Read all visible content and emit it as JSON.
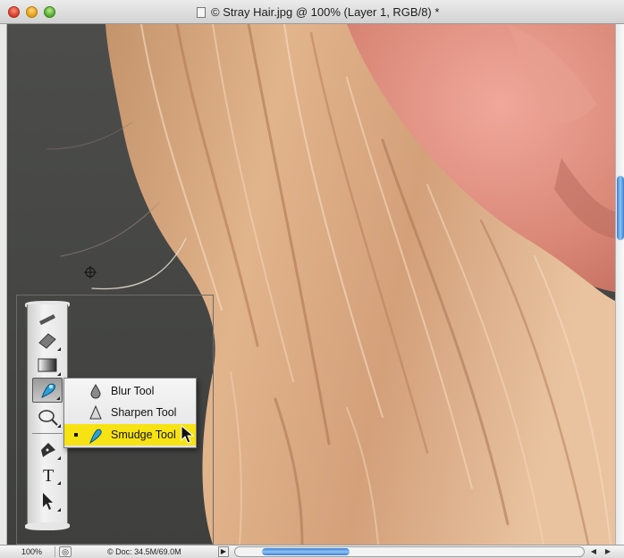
{
  "window": {
    "title": "© Stray Hair.jpg @ 100% (Layer 1, RGB/8) *"
  },
  "toolbar": {
    "tools": [
      {
        "name": "smudge-tool-group",
        "icon": "finger-smudge-icon",
        "active": true
      },
      {
        "name": "dodge-tool",
        "icon": "dodge-icon"
      },
      {
        "name": "pen-tool",
        "icon": "pen-icon"
      },
      {
        "name": "type-tool",
        "icon": "type-icon",
        "glyph": "T"
      },
      {
        "name": "path-selection-tool",
        "icon": "arrow-icon"
      }
    ]
  },
  "flyout": {
    "items": [
      {
        "label": "Blur Tool",
        "icon": "drop-icon",
        "selected": false
      },
      {
        "label": "Sharpen Tool",
        "icon": "triangle-icon",
        "selected": false
      },
      {
        "label": "Smudge Tool",
        "icon": "finger-smudge-icon",
        "selected": true
      }
    ],
    "highlight_color": "#f7e313"
  },
  "status": {
    "zoom": "100%",
    "doc_info": "© Doc: 34.5M/69.0M"
  },
  "colors": {
    "background": "#4b4c4a",
    "scroll_accent": "#3a7fd0"
  }
}
